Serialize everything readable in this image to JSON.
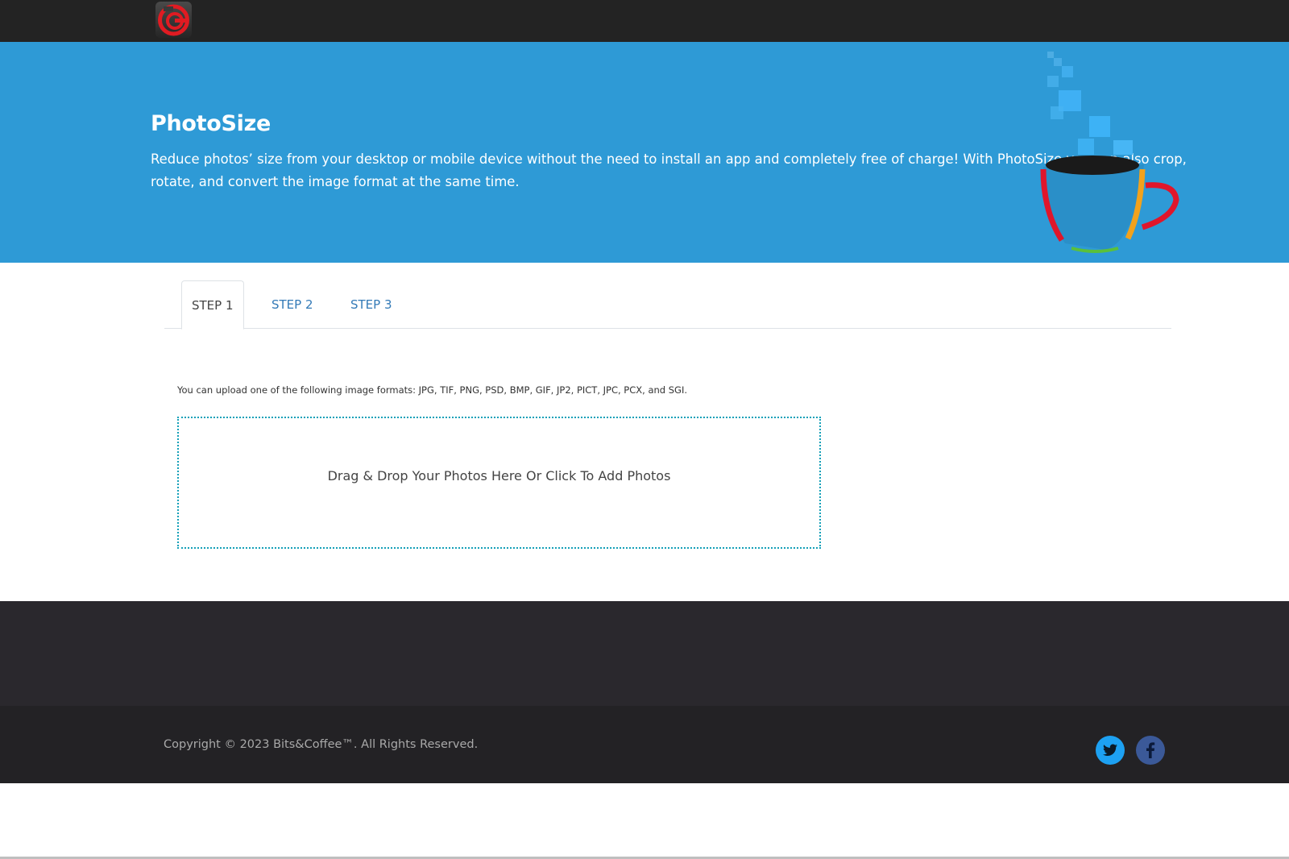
{
  "brand": {
    "logo_icon": "bits-and-coffee-logo-icon"
  },
  "hero": {
    "title": "PhotoSize",
    "description": "Reduce photos’ size from your desktop or mobile device without the need to install an app and completely free of charge! With PhotoSize you can also crop, rotate, and convert the image format at the same time.",
    "art_icon": "coffee-cup-icon",
    "background_color": "#2e9ad6"
  },
  "tabs": [
    {
      "label": "STEP 1",
      "active": true
    },
    {
      "label": "STEP 2",
      "active": false
    },
    {
      "label": "STEP 3",
      "active": false
    }
  ],
  "upload": {
    "formats_text": "You can upload one of the following image formats: JPG, TIF, PNG, PSD, BMP, GIF, JP2, PICT, JPC, PCX, and SGI.",
    "dropzone_label": "Drag & Drop Your Photos Here Or Click To Add Photos"
  },
  "footer": {
    "copyright": "Copyright © 2023 Bits&Coffee™. All Rights Reserved.",
    "social": [
      {
        "icon": "twitter-icon",
        "color": "#1da1f2"
      },
      {
        "icon": "facebook-icon",
        "color": "#3b5998"
      }
    ]
  }
}
